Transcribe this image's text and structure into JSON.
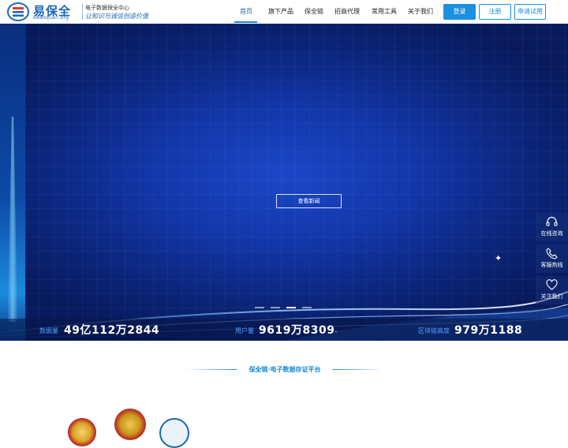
{
  "header": {
    "logo": {
      "name": "易保全",
      "sub": "ebaoquan.org",
      "tagline": "电子数据保全中心",
      "slogan": "让知识与诚信创造价值"
    },
    "nav": [
      {
        "label": "首页",
        "active": true
      },
      {
        "label": "旗下产品",
        "active": false
      },
      {
        "label": "保全链",
        "active": false
      },
      {
        "label": "招商代理",
        "active": false
      },
      {
        "label": "常用工具",
        "active": false
      },
      {
        "label": "关于我们",
        "active": false
      }
    ],
    "login_label": "登录",
    "register_label": "注册",
    "trial_label": "申请试用"
  },
  "hero": {
    "news_button": "查看新闻",
    "carousel": {
      "count": 4,
      "active_index": 2
    },
    "stats": [
      {
        "label": "数据量",
        "value": "49亿112万2844"
      },
      {
        "label": "用户量",
        "value": "9619万8309"
      },
      {
        "label": "区块链高度",
        "value": "979万1188"
      }
    ]
  },
  "float_bar": [
    {
      "label": "在线咨询",
      "icon": "headset-icon"
    },
    {
      "label": "客服热线",
      "icon": "phone-icon"
    },
    {
      "label": "关注我们",
      "icon": "heart-icon"
    }
  ],
  "section": {
    "title": "保全链·电子数据存证平台"
  },
  "colors": {
    "brand": "#1b67b2",
    "accent": "#1b89d6",
    "hero_bg": "#1236a8"
  }
}
